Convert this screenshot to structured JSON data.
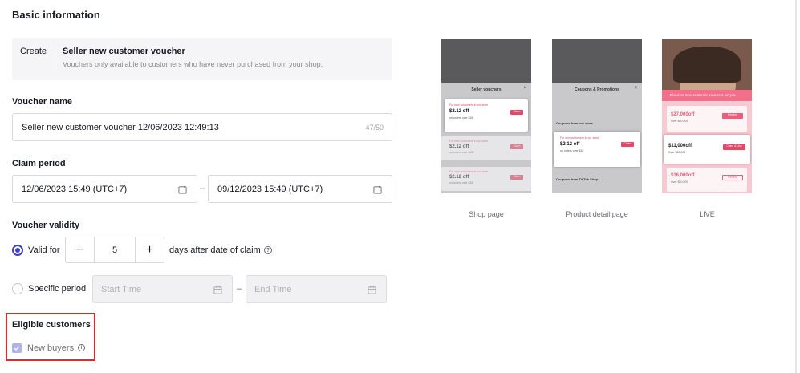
{
  "section_title": "Basic information",
  "create": {
    "tag": "Create",
    "title": "Seller new customer voucher",
    "description": "Vouchers only available to customers who have never purchased from your shop."
  },
  "voucher_name": {
    "label": "Voucher name",
    "value": "Seller new customer voucher 12/06/2023 12:49:13",
    "counter": "47/50"
  },
  "claim_period": {
    "label": "Claim period",
    "start": "12/06/2023 15:49 (UTC+7)",
    "end": "09/12/2023 15:49 (UTC+7)",
    "separator": "–"
  },
  "validity": {
    "label": "Voucher validity",
    "valid_for_label": "Valid for",
    "days_value": "5",
    "days_suffix": "days after date of claim",
    "minus": "−",
    "plus": "+",
    "specific_label": "Specific period",
    "start_placeholder": "Start Time",
    "end_placeholder": "End Time",
    "separator": "–"
  },
  "eligible": {
    "label": "Eligible customers",
    "option": "New buyers"
  },
  "previews": [
    {
      "caption": "Shop page",
      "sheet_title": "Seller vouchers",
      "cards": [
        {
          "tag": "For new customers in our store",
          "price": "$2.12 off",
          "sub": "on orders over $15",
          "btn": "Claim"
        },
        {
          "tag": "For new customers in our store",
          "price": "$2.12 off",
          "sub": "on orders over $15",
          "btn": "Claim"
        },
        {
          "tag": "For new customers in our store",
          "price": "$2.12 off",
          "sub": "on orders over $15",
          "btn": "Claim"
        }
      ]
    },
    {
      "caption": "Product detail page",
      "sheet_title": "Coupons & Promotions",
      "section_a": "Coupons from our store",
      "section_b": "Coupons from TikTok Shop",
      "cards": [
        {
          "tag": "For new customers in our store",
          "price": "$2.12 off",
          "sub": "on orders over $15",
          "btn": "Claim"
        }
      ]
    },
    {
      "caption": "LIVE",
      "banner": "Discover new-customer vouchers for you",
      "cards": [
        {
          "price": "$27,000off",
          "sub": "Over $60,000",
          "btn": "Remind"
        },
        {
          "price": "$11,000off",
          "sub": "Over $20,000",
          "btn": "Claim & Use"
        },
        {
          "price": "$16,000off",
          "sub": "Over $50,000",
          "btn": "Remind"
        }
      ]
    }
  ],
  "colors": {
    "accent": "#3c3cdf",
    "highlight_border": "#e02b2b",
    "brand_pink": "#e94565",
    "checkbox_disabled": "#b3b0ee"
  }
}
